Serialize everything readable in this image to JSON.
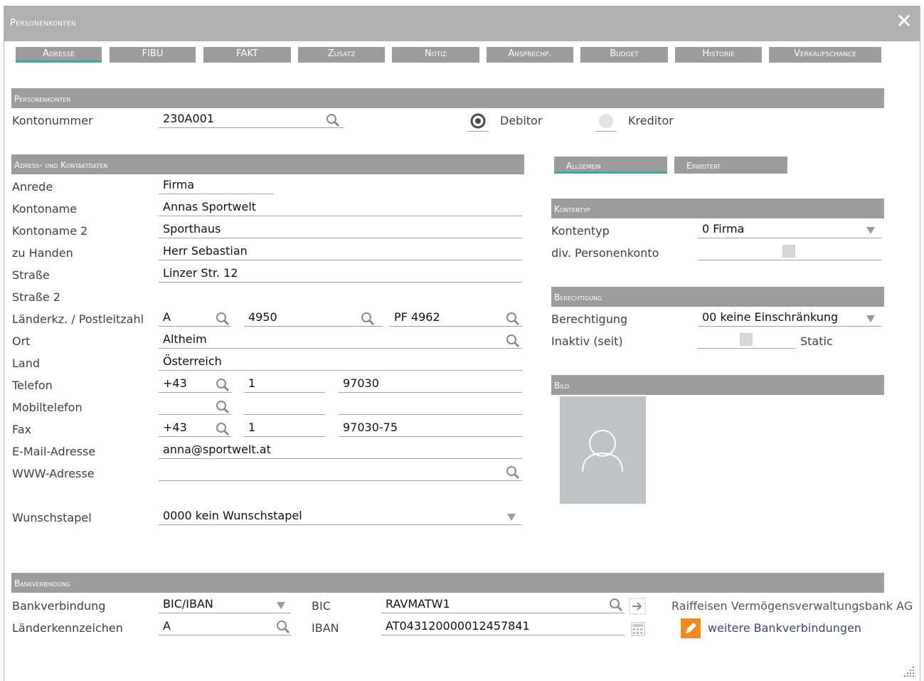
{
  "window": {
    "title": "Personenkonten",
    "close_label": "✕"
  },
  "tabs": [
    {
      "label": "Adresse",
      "active": true
    },
    {
      "label": "FIBU"
    },
    {
      "label": "FAKT"
    },
    {
      "label": "Zusatz"
    },
    {
      "label": "Notiz"
    },
    {
      "label": "Ansprechp."
    },
    {
      "label": "Budget"
    },
    {
      "label": "Historie"
    },
    {
      "label": "Verkaufschance"
    }
  ],
  "sections": {
    "personenkonten": "Personenkonten",
    "adress": "Adress- und Kontaktdaten",
    "kontentyp": "Kontentyp",
    "berechtigung": "Berechtigung",
    "bild": "Bild",
    "bank": "Bankverbindung"
  },
  "konto": {
    "label": "Kontonummer",
    "value": "230A001",
    "debitor": "Debitor",
    "kreditor": "Kreditor",
    "selected": "Debitor"
  },
  "address": {
    "anrede": {
      "label": "Anrede",
      "value": "Firma"
    },
    "kontoname": {
      "label": "Kontoname",
      "value": "Annas Sportwelt"
    },
    "kontoname2": {
      "label": "Kontoname 2",
      "value": "Sporthaus"
    },
    "zuhanden": {
      "label": "zu Handen",
      "value": "Herr Sebastian"
    },
    "strasse": {
      "label": "Straße",
      "value": "Linzer Str. 12"
    },
    "strasse2": {
      "label": "Straße 2",
      "value": ""
    },
    "plz": {
      "label": "Länderkz. / Postleitzahl",
      "land": "A",
      "plz": "4950",
      "pf": "PF 4962"
    },
    "ort": {
      "label": "Ort",
      "value": "Altheim"
    },
    "land": {
      "label": "Land",
      "value": "Österreich"
    },
    "telefon": {
      "label": "Telefon",
      "cc": "+43",
      "area": "1",
      "number": "97030"
    },
    "mobil": {
      "label": "Mobiltelefon",
      "cc": "",
      "area": "",
      "number": ""
    },
    "fax": {
      "label": "Fax",
      "cc": "+43",
      "area": "1",
      "number": "97030-75"
    },
    "email": {
      "label": "E-Mail-Adresse",
      "value": "anna@sportwelt.at"
    },
    "www": {
      "label": "WWW-Adresse",
      "value": ""
    },
    "wunsch": {
      "label": "Wunschstapel",
      "value": "0000 kein Wunschstapel"
    }
  },
  "subtabs": [
    {
      "label": "Allgemein",
      "active": true
    },
    {
      "label": "Erweitert"
    }
  ],
  "kontentyp": {
    "label": "Kontentyp",
    "value": "0 Firma",
    "div_label": "div. Personenkonto"
  },
  "berechtigung": {
    "label": "Berechtigung",
    "value": "00 keine Einschränkung",
    "inaktiv_label": "Inaktiv (seit)",
    "static_label": "Static"
  },
  "bank": {
    "label": "Bankverbindung",
    "value": "BIC/IBAN",
    "lk_label": "Länderkennzeichen",
    "lk_value": "A",
    "bic_label": "BIC",
    "bic_value": "RAVMATW1",
    "iban_label": "IBAN",
    "iban_value": "AT043120000012457841",
    "bank_name": "Raiffeisen Vermögensverwaltungsbank AG",
    "more_link": "weitere Bankverbindungen"
  },
  "colors": {
    "header": "#9c9c9c",
    "accent": "#3fa89a",
    "edit_icon": "#f08a24"
  }
}
